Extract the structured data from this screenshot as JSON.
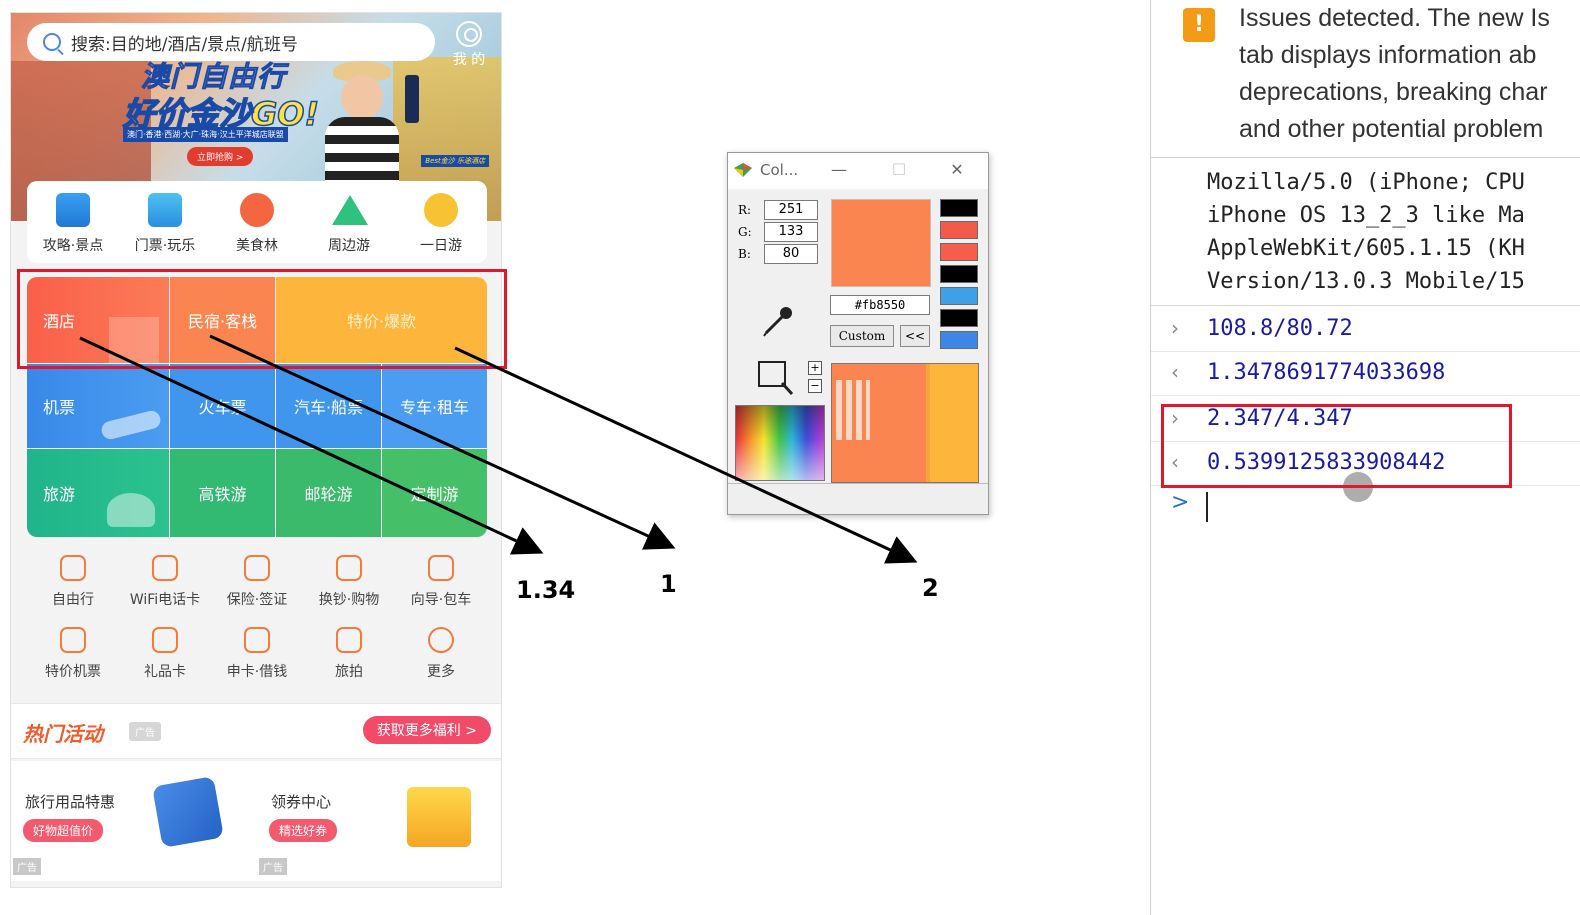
{
  "phone": {
    "search": {
      "placeholder": "搜索:目的地/酒店/景点/航班号"
    },
    "mine_label": "我 的",
    "banner": {
      "headline1": "澳门自由行",
      "headline2": "好价金沙GO!",
      "tagline": "澳门·香港·西湖·大广·珠海·汉土平洋城店联盟",
      "cta": "立即抢购 >",
      "brand": "Best金沙 乐途酒店"
    },
    "nav_icons": [
      {
        "label": "攻略·景点",
        "icon": "guide-book-icon"
      },
      {
        "label": "门票·玩乐",
        "icon": "ticket-image-icon"
      },
      {
        "label": "美食林",
        "icon": "food-icon"
      },
      {
        "label": "周边游",
        "icon": "mountain-icon"
      },
      {
        "label": "一日游",
        "icon": "sun-icon"
      }
    ],
    "grid": {
      "row1": [
        "酒店",
        "民宿·客栈",
        "特价·爆款"
      ],
      "row2": [
        "机票",
        "火车票",
        "汽车·船票",
        "专车·租车"
      ],
      "row3": [
        "旅游",
        "高铁游",
        "邮轮游",
        "定制游"
      ]
    },
    "services": [
      {
        "label": "自由行",
        "icon": "backpack-icon"
      },
      {
        "label": "WiFi电话卡",
        "icon": "wifi-card-icon"
      },
      {
        "label": "保险·签证",
        "icon": "shield-icon"
      },
      {
        "label": "换钞·购物",
        "icon": "shopping-bag-icon"
      },
      {
        "label": "向导·包车",
        "icon": "guide-hat-icon"
      },
      {
        "label": "特价机票",
        "icon": "plane-icon"
      },
      {
        "label": "礼品卡",
        "icon": "gift-card-icon"
      },
      {
        "label": "申卡·借钱",
        "icon": "credit-card-icon"
      },
      {
        "label": "旅拍",
        "icon": "camera-icon"
      },
      {
        "label": "更多",
        "icon": "more-icon"
      }
    ],
    "hot": {
      "title": "热门活动",
      "ad_tag": "广告",
      "more_button": "获取更多福利 >"
    },
    "promos": [
      {
        "title": "旅行用品特惠",
        "badge": "好物超值价",
        "ad": "广告"
      },
      {
        "title": "领券中心",
        "badge": "精选好券",
        "ad": "广告"
      }
    ]
  },
  "annotations": {
    "a1": "1.34",
    "a2": "1",
    "a3": "2"
  },
  "color_picker": {
    "title": "Col...",
    "r_label": "R:",
    "g_label": "G:",
    "b_label": "B:",
    "r": "251",
    "g": "133",
    "b": "80",
    "hex": "#fb8550",
    "custom_button": "Custom",
    "back_button": "<<",
    "zoom_in": "+",
    "zoom_out": "−",
    "selected_color": "#fb8550",
    "recent_swatches": [
      "#000000",
      "#f35a4a",
      "#f85c4a",
      "#000000",
      "#3ea0e6",
      "#000000",
      "#3b86e6"
    ]
  },
  "devtools": {
    "warning_text": [
      "Issues detected. The new Is",
      "tab displays information ab",
      "deprecations, breaking char",
      "and other potential problem"
    ],
    "user_agent": [
      "Mozilla/5.0 (iPhone; CPU",
      "iPhone OS 13_2_3 like Ma",
      "AppleWebKit/605.1.15 (KH",
      "Version/13.0.3 Mobile/15"
    ],
    "console": [
      {
        "type": "input",
        "text": "108.8/80.72"
      },
      {
        "type": "output",
        "text": "1.3478691774033698"
      },
      {
        "type": "input",
        "text": "2.347/4.347"
      },
      {
        "type": "output",
        "text": "0.5399125833908442"
      }
    ],
    "prompt_symbol": ">"
  }
}
